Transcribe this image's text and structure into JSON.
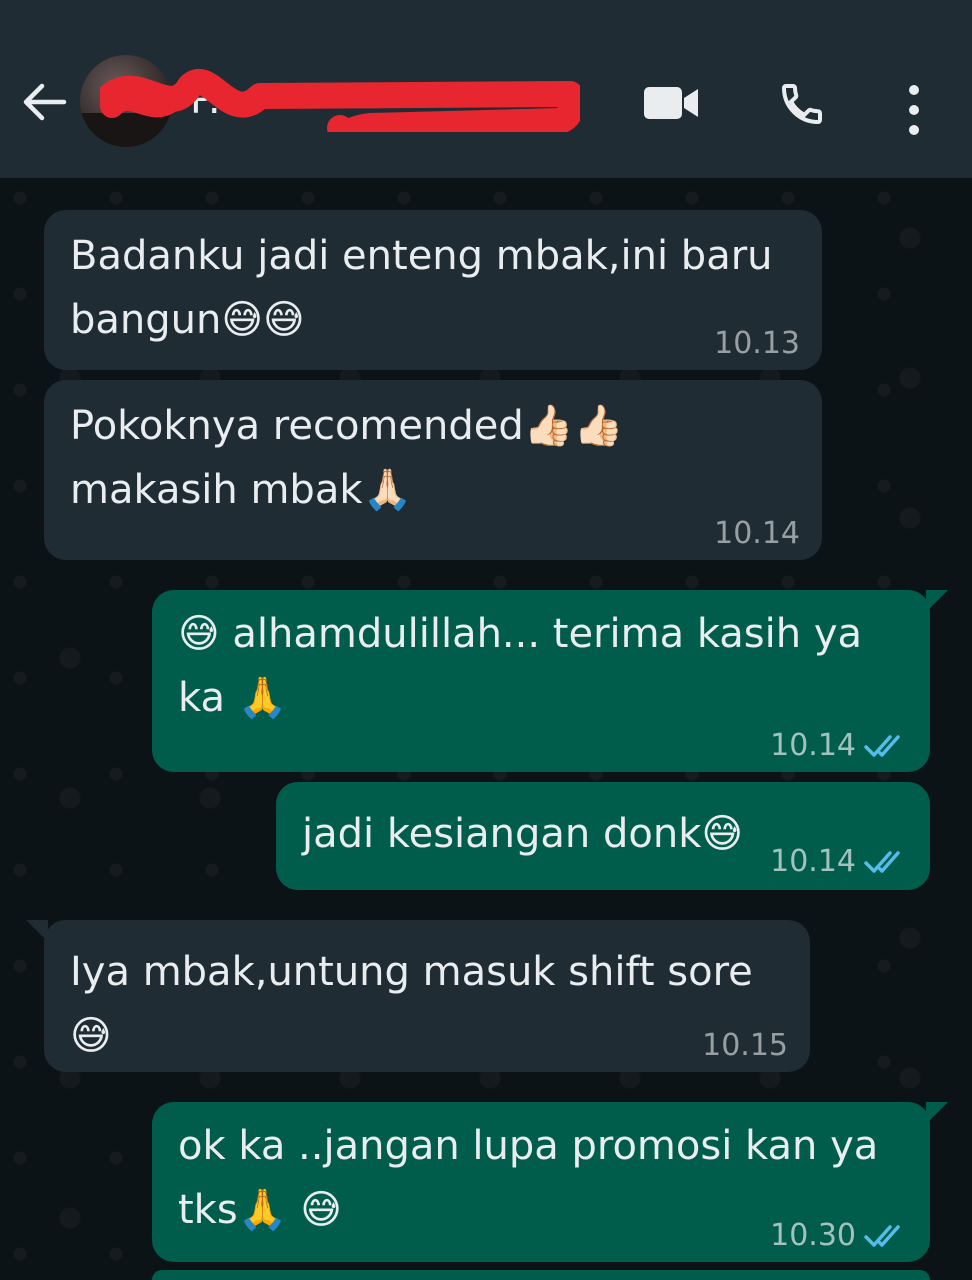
{
  "header": {
    "contact_name": "P...",
    "icons": [
      "back-arrow-icon",
      "video-call-icon",
      "phone-call-icon",
      "more-vert-icon"
    ]
  },
  "messages": [
    {
      "dir": "in",
      "text": "Badanku jadi enteng mbak,ini baru bangun😅😅",
      "time": "10.13"
    },
    {
      "dir": "in",
      "text": "Pokoknya recomended👍🏻👍🏻 makasih mbak🙏🏻",
      "time": "10.14"
    },
    {
      "dir": "out",
      "text": "😅 alhamdulillah... terima kasih ya ka 🙏",
      "time": "10.14",
      "status": "read"
    },
    {
      "dir": "out",
      "text": "jadi kesiangan donk😅",
      "time": "10.14",
      "status": "read"
    },
    {
      "dir": "in",
      "text": "Iya mbak,untung masuk shift sore😅",
      "time": "10.15"
    },
    {
      "dir": "out",
      "text": "ok ka ..jangan lupa promosi kan ya tks🙏 😅",
      "time": "10.30",
      "status": "read"
    }
  ],
  "colors": {
    "header_bg": "#1f2c34",
    "incoming_bubble": "#1f2c34",
    "outgoing_bubble": "#005c4b",
    "read_tick": "#53bdeb",
    "redaction": "#e8262f"
  }
}
